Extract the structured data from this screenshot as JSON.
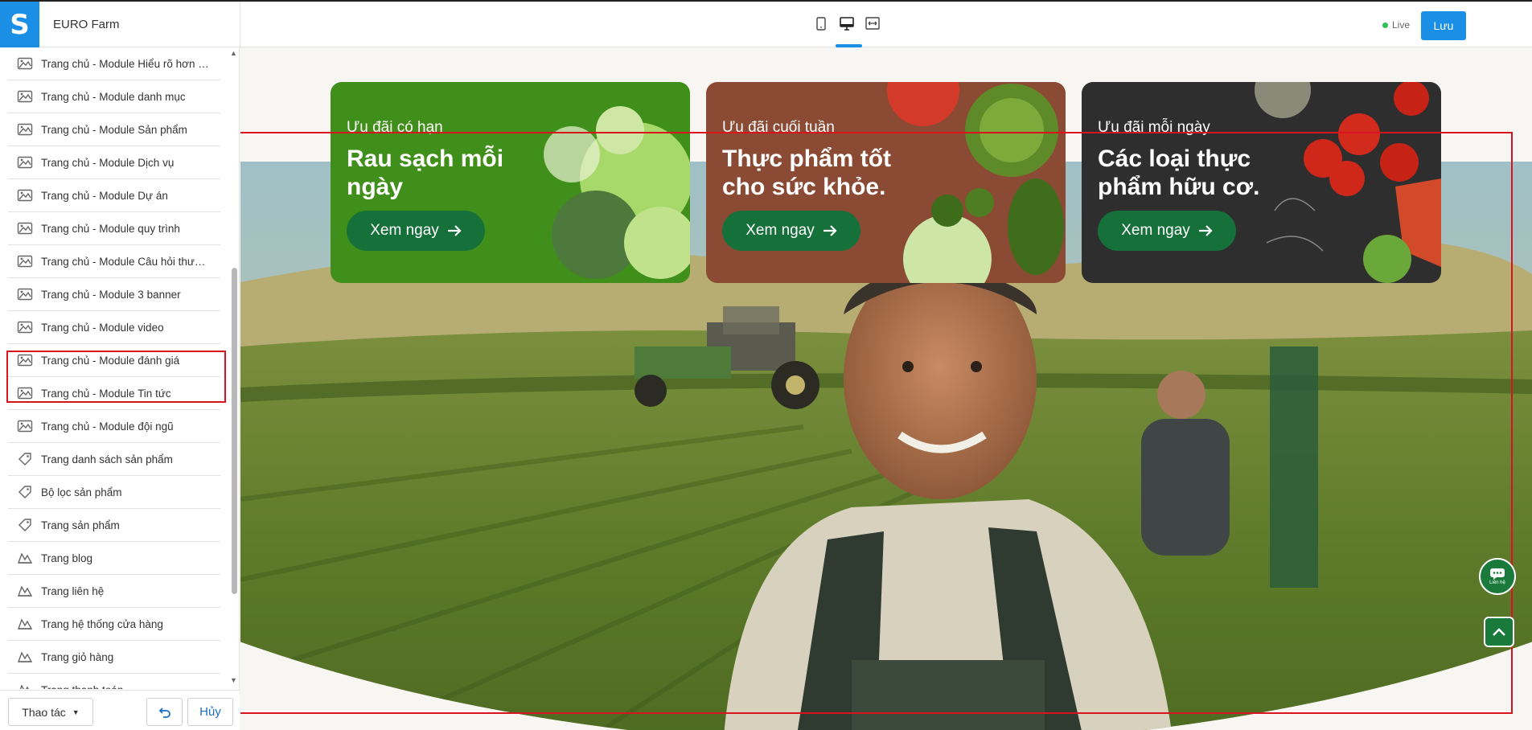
{
  "header": {
    "app_title": "EURO Farm",
    "view_modes": [
      "mobile-view-icon",
      "desktop-view-icon",
      "fullwidth-view-icon"
    ],
    "active_view": "desktop",
    "live_label": "Live",
    "save_label": "Lưu"
  },
  "sidebar": {
    "items": [
      {
        "label": "Trang chủ - Module Hiểu rõ hơn về chúng tôi",
        "icon": "image-icon"
      },
      {
        "label": "Trang chủ - Module danh mục",
        "icon": "image-icon"
      },
      {
        "label": "Trang chủ - Module Sản phẩm",
        "icon": "image-icon"
      },
      {
        "label": "Trang chủ - Module Dịch vụ",
        "icon": "image-icon"
      },
      {
        "label": "Trang chủ - Module Dự án",
        "icon": "image-icon"
      },
      {
        "label": "Trang chủ - Module quy trình",
        "icon": "image-icon"
      },
      {
        "label": "Trang chủ - Module Câu hỏi thường gặp",
        "icon": "image-icon"
      },
      {
        "label": "Trang chủ - Module 3 banner",
        "icon": "image-icon"
      },
      {
        "label": "Trang chủ - Module video",
        "icon": "image-icon"
      },
      {
        "label": "Trang chủ - Module đánh giá",
        "icon": "image-icon"
      },
      {
        "label": "Trang chủ - Module Tin tức",
        "icon": "image-icon"
      },
      {
        "label": "Trang chủ - Module đội ngũ",
        "icon": "image-icon"
      },
      {
        "label": "Trang danh sách sản phẩm",
        "icon": "tag-icon"
      },
      {
        "label": "Bộ lọc sản phẩm",
        "icon": "tag-icon"
      },
      {
        "label": "Trang sản phẩm",
        "icon": "tag-icon"
      },
      {
        "label": "Trang blog",
        "icon": "blog-icon"
      },
      {
        "label": "Trang liên hệ",
        "icon": "blog-icon"
      },
      {
        "label": "Trang hệ thống cửa hàng",
        "icon": "blog-icon"
      },
      {
        "label": "Trang giỏ hàng",
        "icon": "blog-icon"
      },
      {
        "label": "Trang thanh toán",
        "icon": "blog-icon"
      }
    ],
    "selected_index": 8,
    "actions_label": "Thao tác",
    "cancel_label": "Hủy"
  },
  "banners": [
    {
      "eyebrow": "Ưu đãi có hạn",
      "headline": "Rau sạch mỗi ngày",
      "cta": "Xem ngay",
      "color": "#4a9a1f"
    },
    {
      "eyebrow": "Ưu đãi cuối tuần",
      "headline": "Thực phẩm tốt cho sức khỏe.",
      "cta": "Xem ngay",
      "color": "#8a4a33"
    },
    {
      "eyebrow": "Ưu đãi mỗi ngày",
      "headline": "Các loại thực phẩm hữu cơ.",
      "cta": "Xem ngay",
      "color": "#2e2e2e"
    }
  ],
  "floating": {
    "contact_label": "Liên hệ"
  },
  "colors": {
    "accent": "#1b8fe6",
    "brand_green": "#15703a",
    "highlight": "#d9141c",
    "live": "#2ec05a"
  }
}
